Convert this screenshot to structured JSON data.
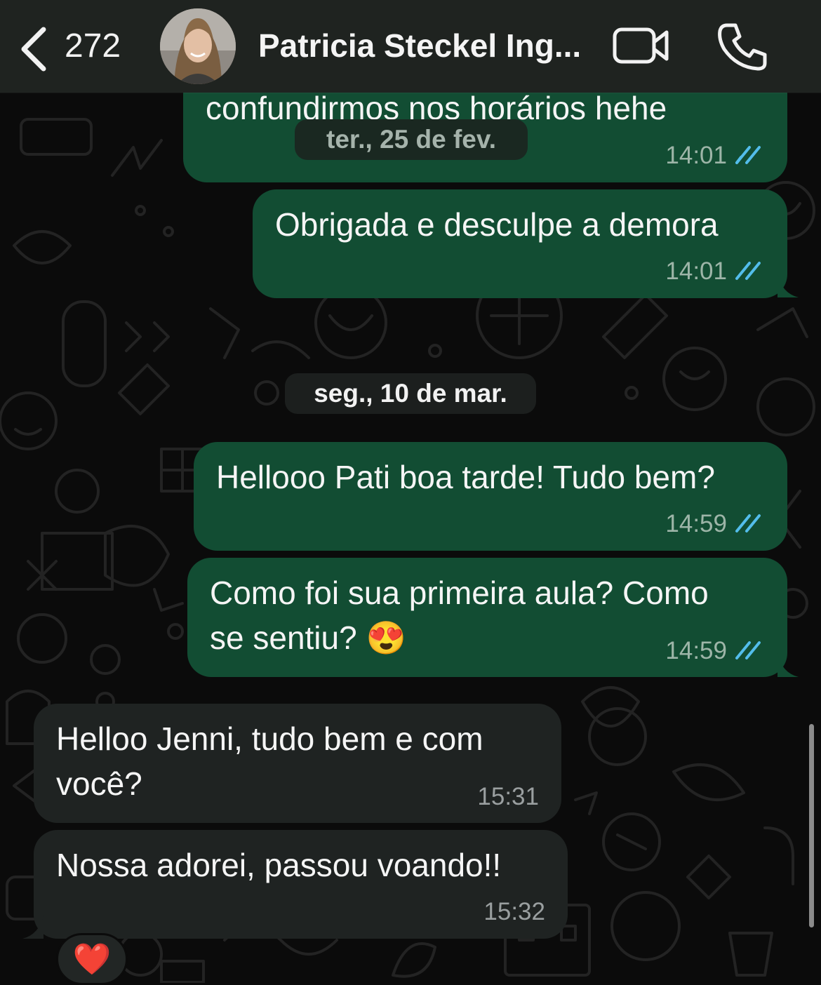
{
  "header": {
    "back_count": "272",
    "contact_name": "Patricia Steckel Ing...",
    "icons": [
      "chevron-left-icon",
      "video-call-icon",
      "phone-icon"
    ]
  },
  "colors": {
    "outgoing_bubble": "#124d33",
    "incoming_bubble": "#1f2322",
    "read_ticks": "#53bdeb",
    "background": "#0b0b0b"
  },
  "chat": {
    "date_chip_top": "ter., 25 de fev.",
    "date_chip_main": "seg., 10 de mar.",
    "messages": [
      {
        "direction": "out",
        "lines": [
          "confundirmos nos horários hehe"
        ],
        "time": "14:01",
        "status": "read"
      },
      {
        "direction": "out",
        "lines": [
          "Obrigada e desculpe a demora"
        ],
        "time": "14:01",
        "status": "read"
      },
      {
        "direction": "out",
        "lines": [
          "Hellooo Pati boa tarde! Tudo bem?"
        ],
        "time": "14:59",
        "status": "read"
      },
      {
        "direction": "out",
        "lines": [
          "Como foi sua primeira aula? Como",
          "se sentiu? 😍"
        ],
        "time": "14:59",
        "status": "read"
      },
      {
        "direction": "in",
        "lines": [
          "Helloo Jenni, tudo bem e com",
          "você?"
        ],
        "time": "15:31"
      },
      {
        "direction": "in",
        "lines": [
          "Nossa adorei, passou voando!!"
        ],
        "time": "15:32",
        "reaction": "❤️"
      }
    ]
  }
}
